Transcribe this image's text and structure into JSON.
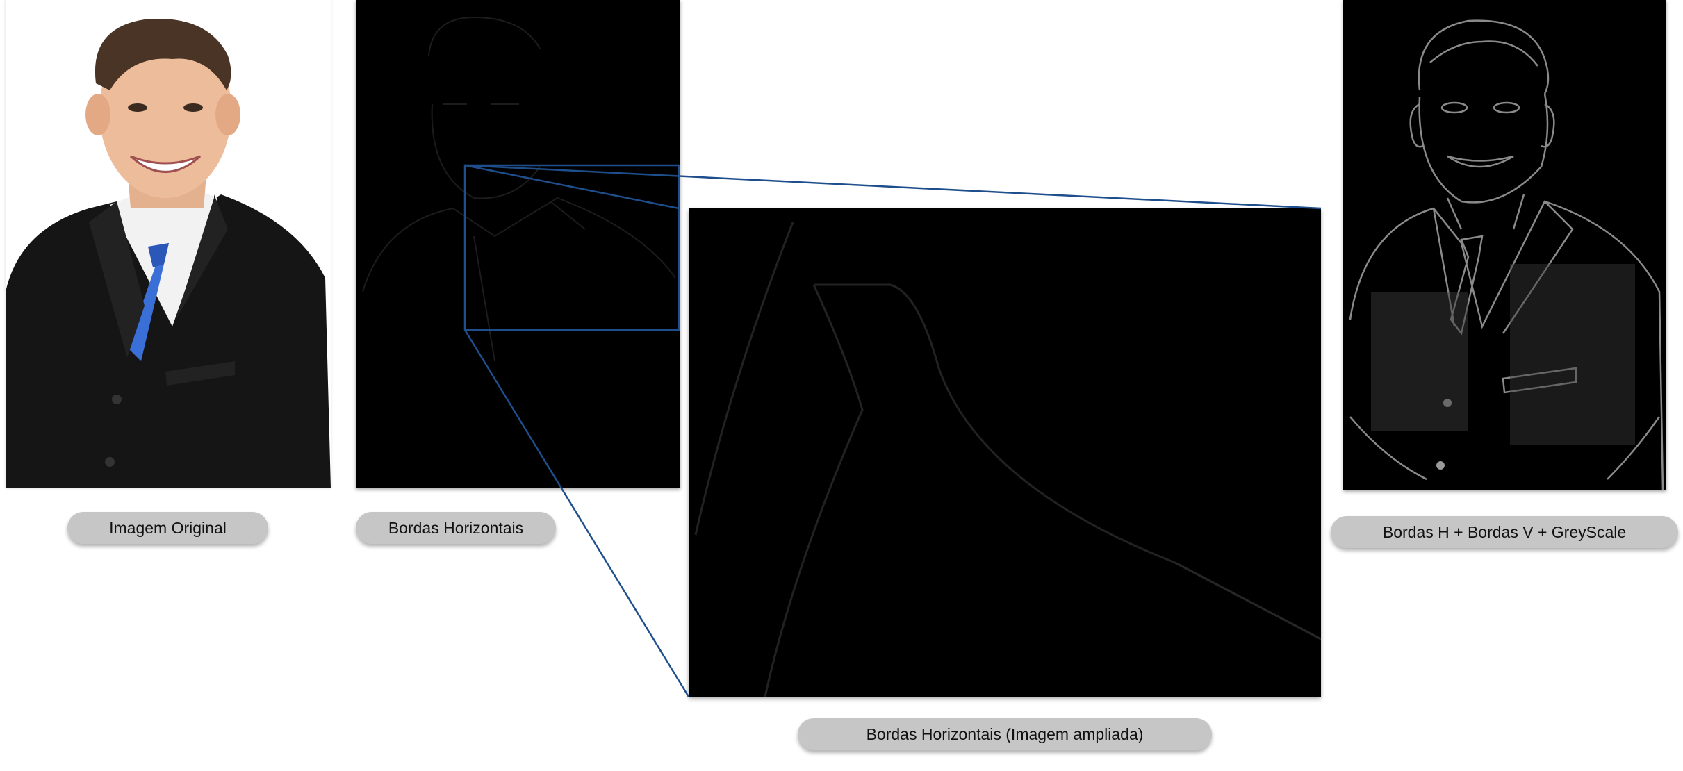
{
  "panels": {
    "original": {
      "caption": "Imagem Original"
    },
    "horizontal_edges": {
      "caption": "Bordas Horizontais"
    },
    "horizontal_edges_zoomed": {
      "caption": "Bordas Horizontais (Imagem ampliada)"
    },
    "combined": {
      "caption": "Bordas H + Bordas V  + GreyScale"
    }
  },
  "colors": {
    "zoom_outline": "#1f4e8c",
    "caption_background": "#c6c6c6",
    "edge_background": "#000000"
  }
}
